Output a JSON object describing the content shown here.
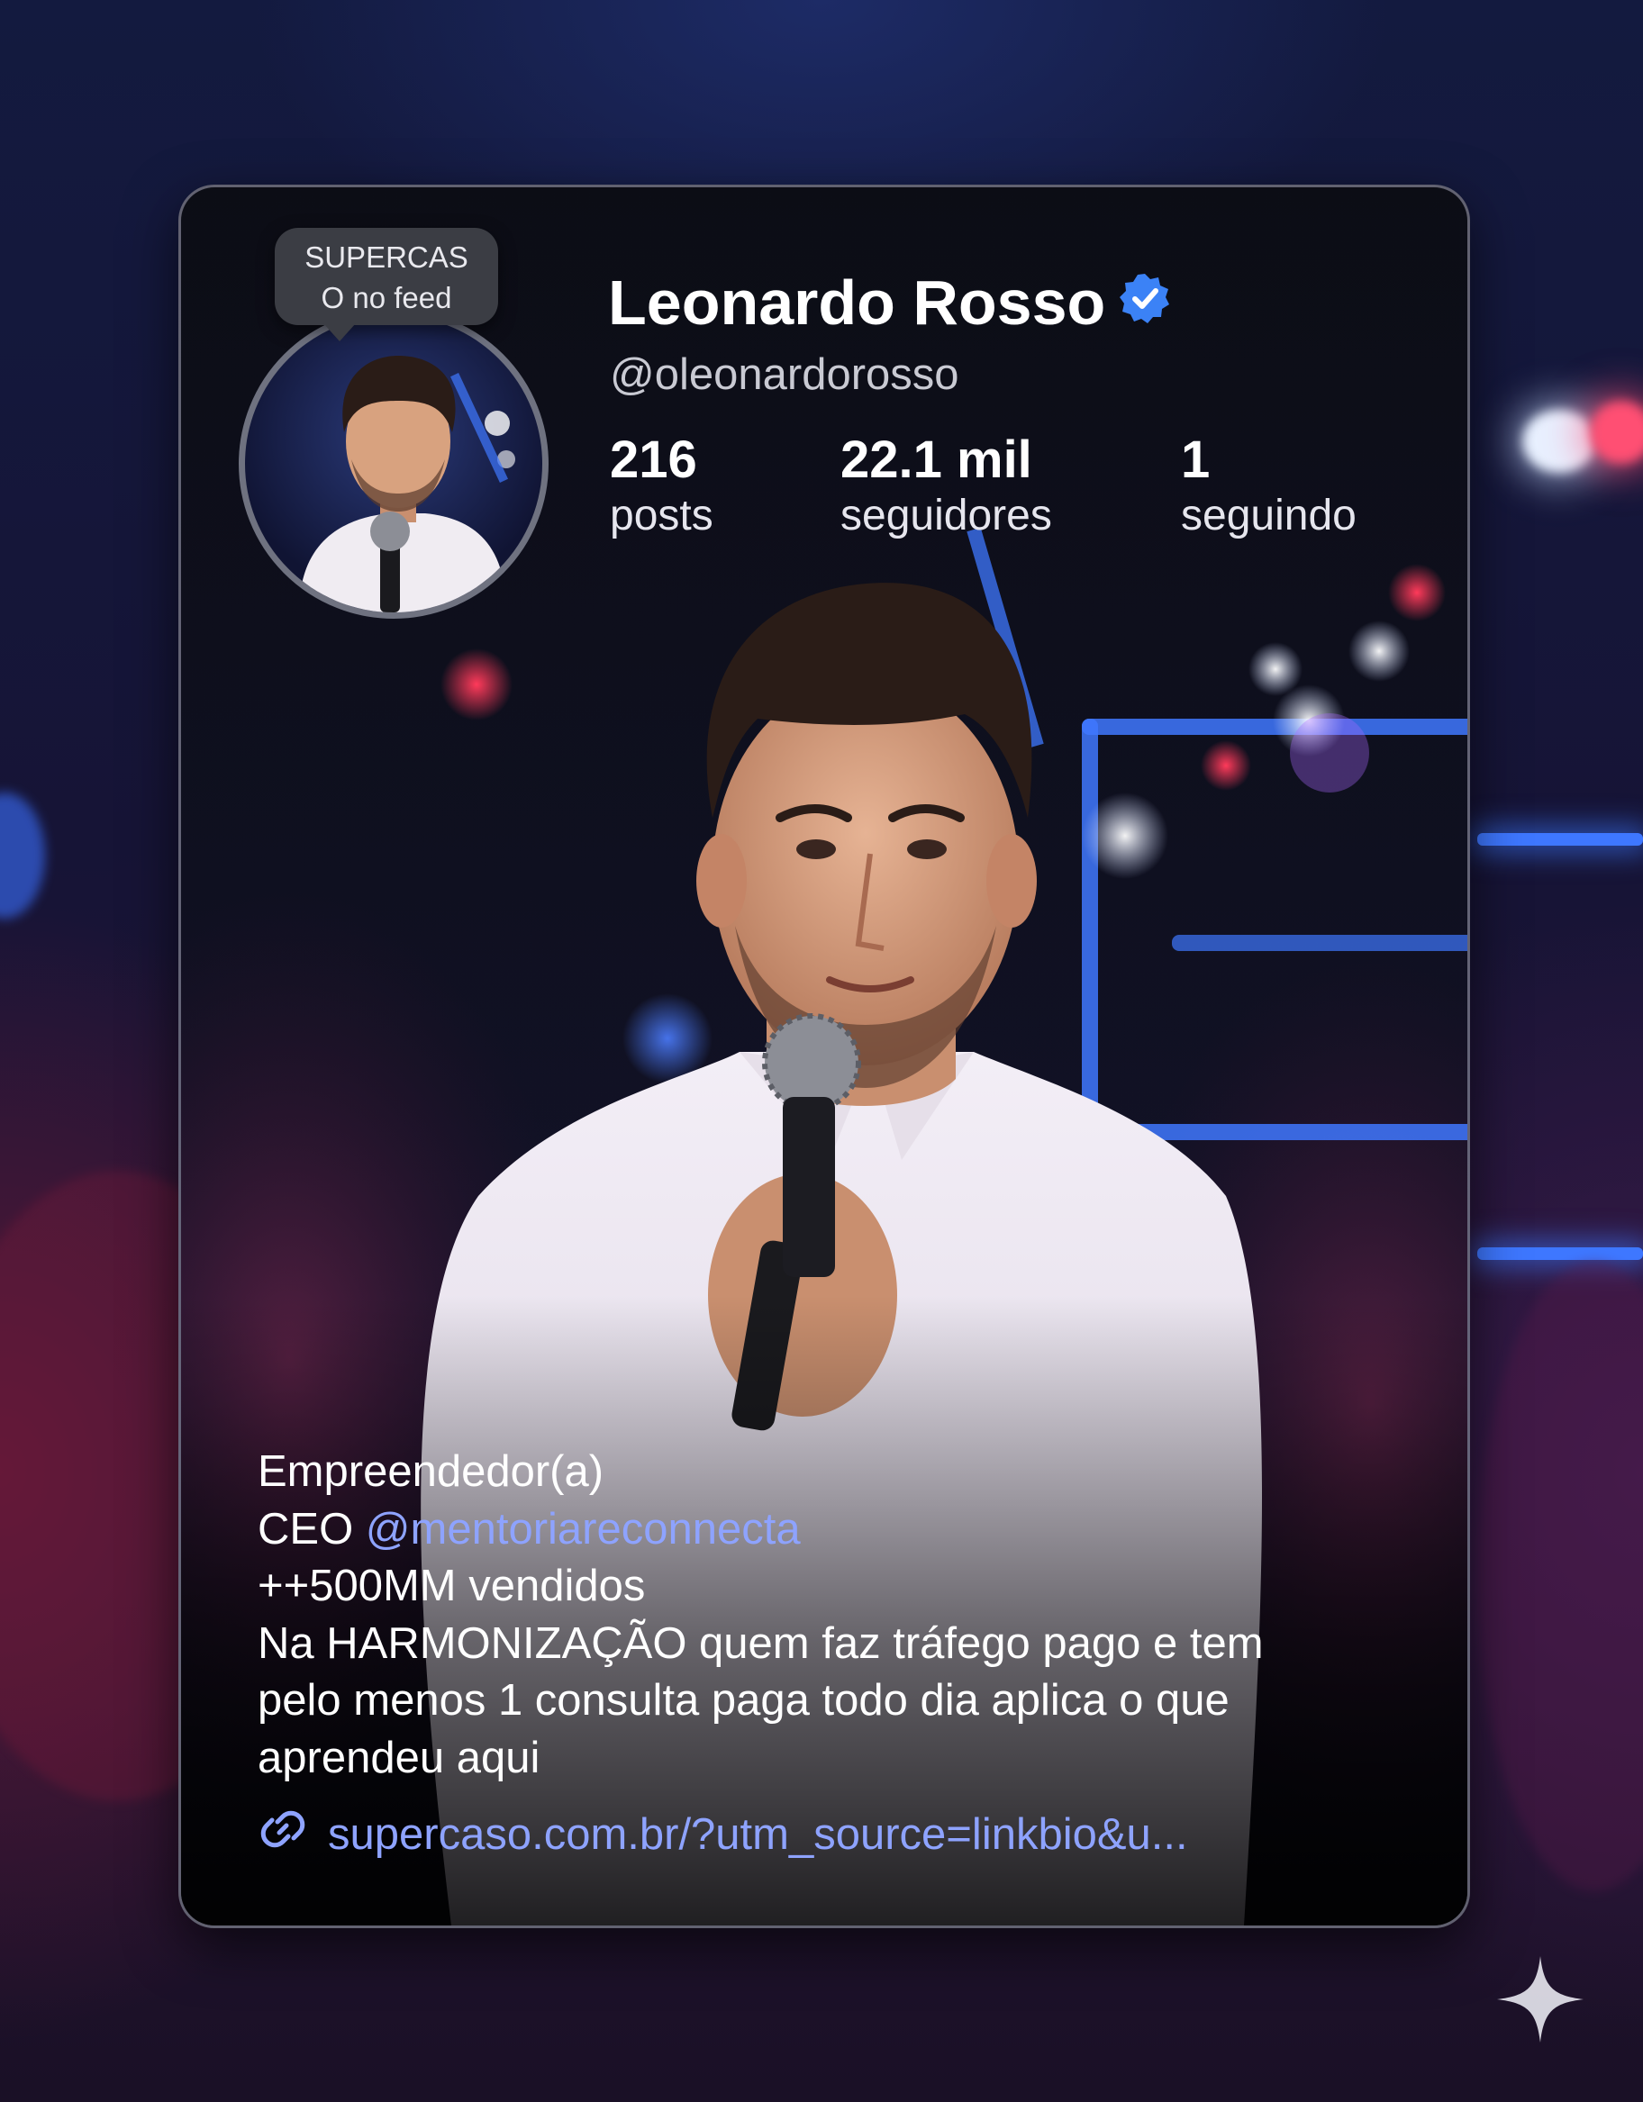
{
  "profile": {
    "name": "Leonardo Rosso",
    "handle": "@oleonardorosso",
    "verified": true,
    "tooltip": {
      "line1": "SUPERCAS",
      "line2": "O no feed"
    },
    "stats": [
      {
        "value": "216",
        "label": "posts"
      },
      {
        "value": "22.1 mil",
        "label": "seguidores"
      },
      {
        "value": "1",
        "label": "seguindo"
      }
    ],
    "bio": {
      "line1": "Empreendedor(a)",
      "line2_prefix": "CEO ",
      "line2_mention": "@mentoriareconnecta",
      "line3": "++500MM vendidos",
      "line4": "Na HARMONIZAÇÃO quem faz tráfego pago e tem",
      "line5": "pelo menos 1 consulta paga todo dia aplica o que",
      "line6": "aprendeu aqui"
    },
    "link": "supercaso.com.br/?utm_source=linkbio&u..."
  },
  "icons": {
    "verified": "verified-badge-icon",
    "link": "link-icon",
    "corner": "sparkle-icon"
  },
  "colors": {
    "accent": "#3b82f6",
    "mention": "#8ea3ff",
    "card_border": "#9a9aae"
  }
}
